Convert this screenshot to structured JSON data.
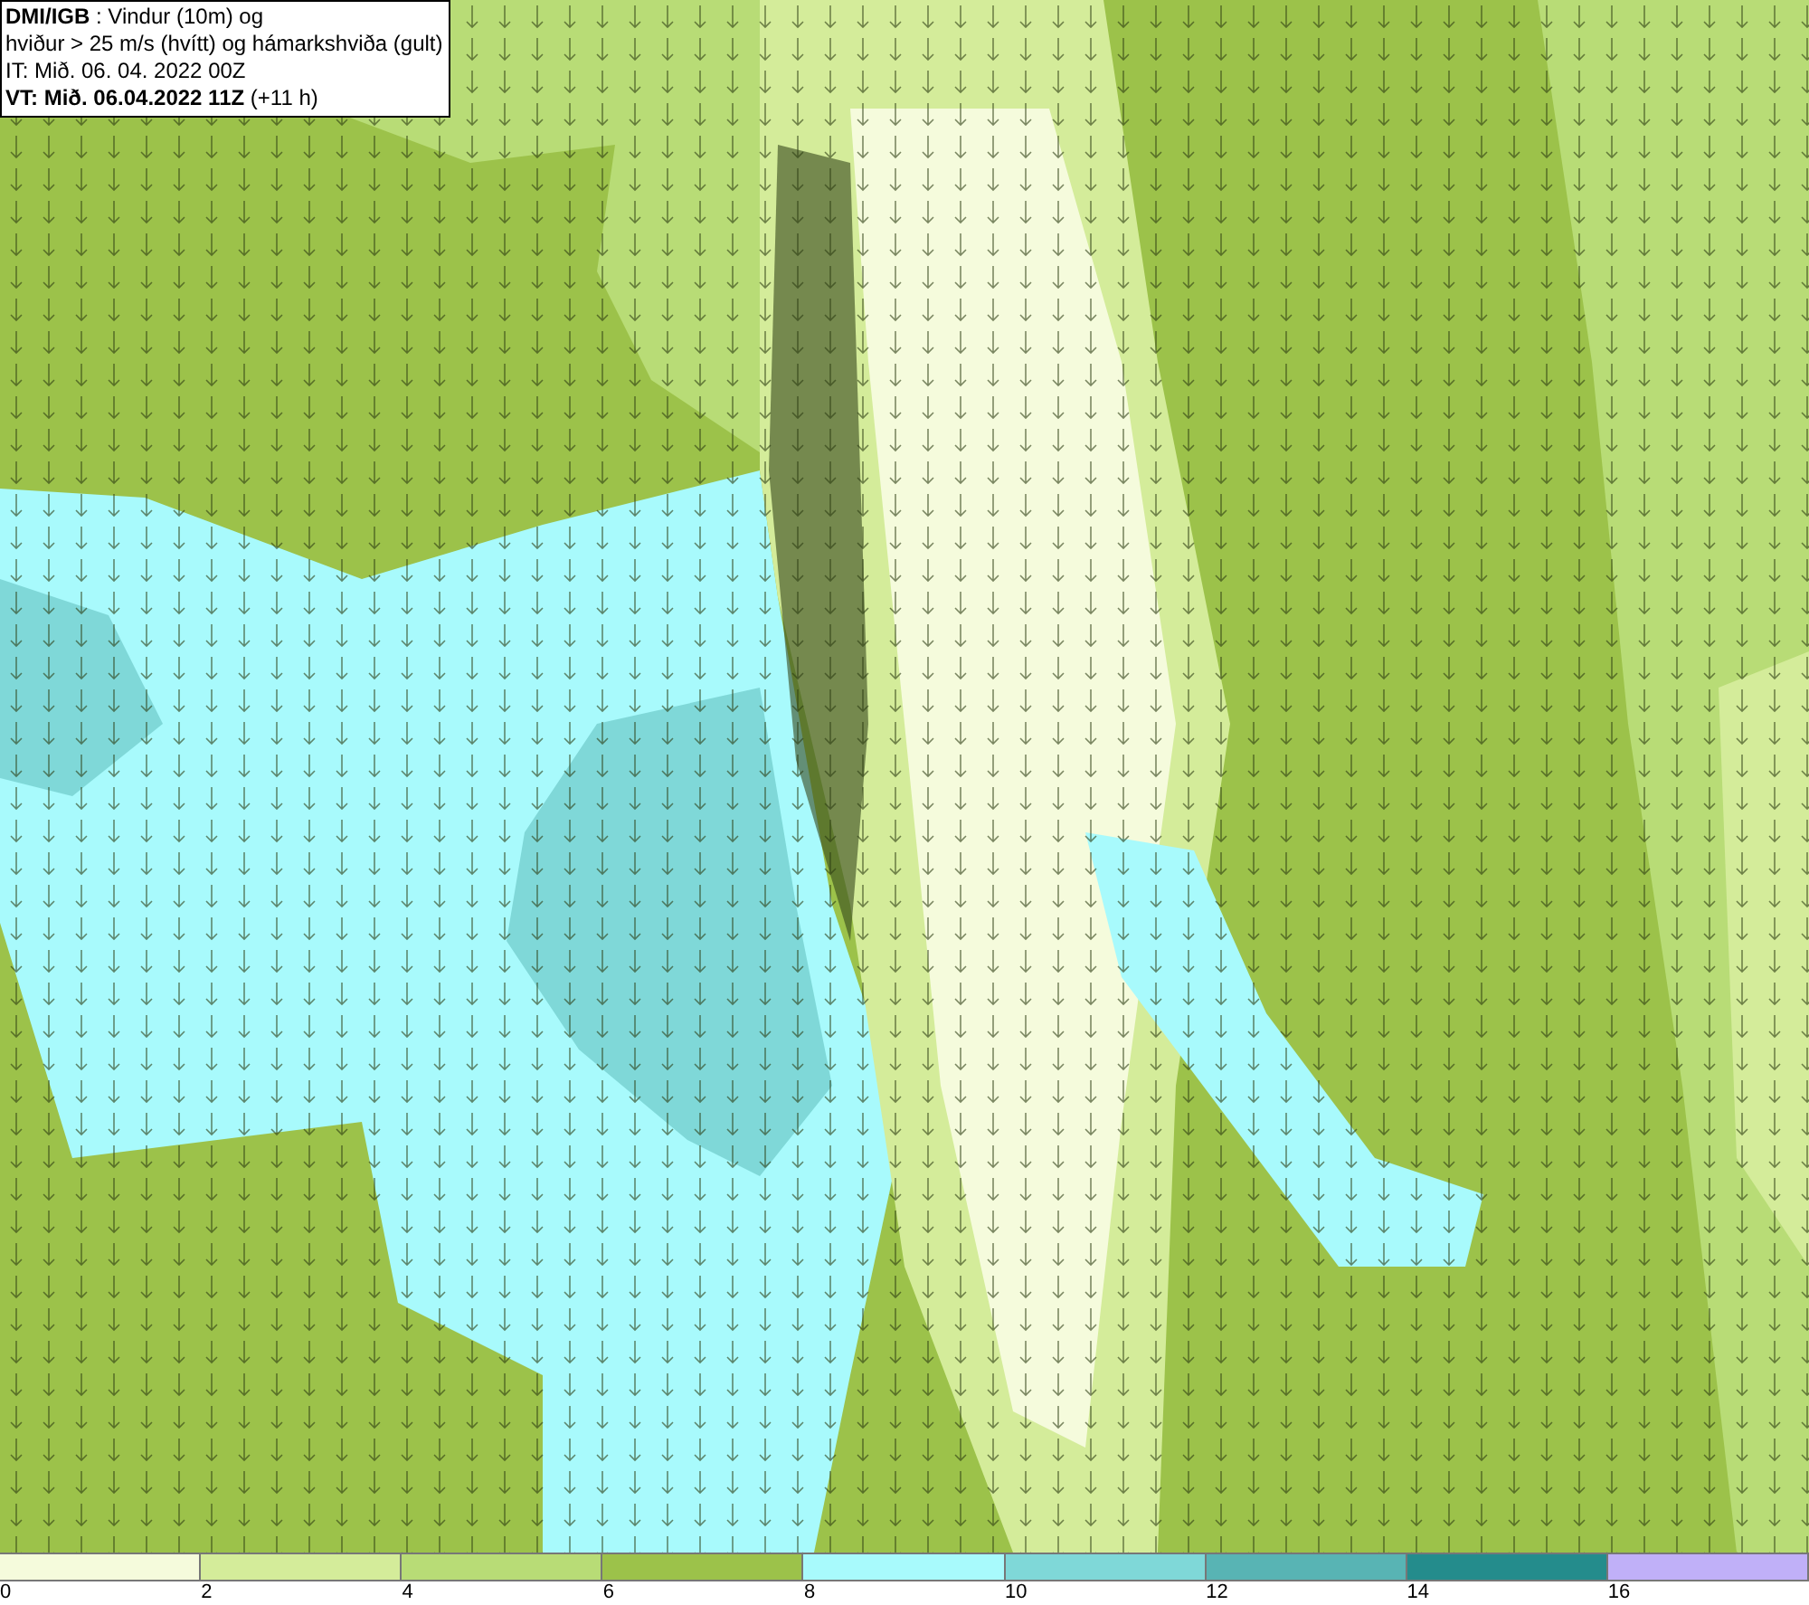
{
  "header": {
    "lines": [
      "**DMI/IGB** : Vindur (10m) og",
      "hviður > 25 m/s (hvítt) og hámarkshviða (gult)",
      "IT: Mið. 06. 04. 2022 00Z",
      "**VT: Mið. 06.04.2022 11Z** (+11 h)"
    ]
  },
  "legend": [
    {
      "color": "#f5fbdc",
      "label": "0"
    },
    {
      "color": "#d4ec9a",
      "label": "2"
    },
    {
      "color": "#b8dc76",
      "label": "4"
    },
    {
      "color": "#9cc24a",
      "label": "6"
    },
    {
      "color": "#a8fafc",
      "label": "8"
    },
    {
      "color": "#7fd8d8",
      "label": "10"
    },
    {
      "color": "#58b4b4",
      "label": "12"
    },
    {
      "color": "#248c8c",
      "label": "14"
    },
    {
      "color": "#c0b0f8",
      "label": "16"
    }
  ]
}
